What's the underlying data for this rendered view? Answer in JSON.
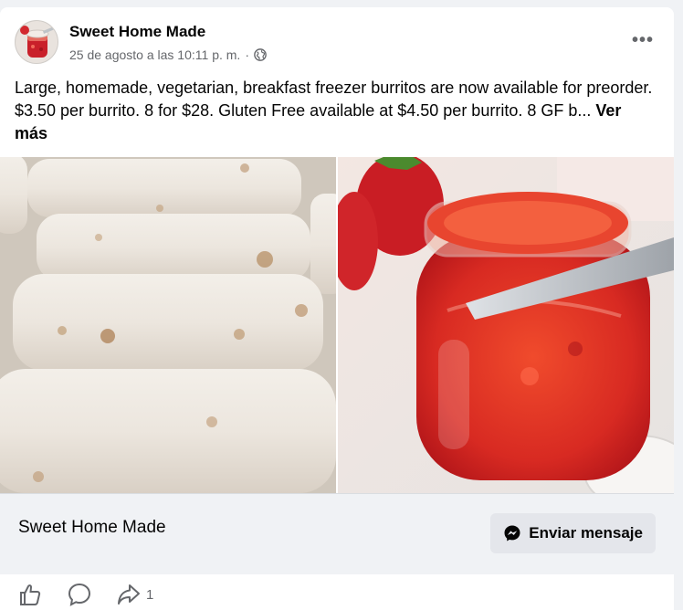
{
  "post": {
    "author": "Sweet Home Made",
    "date": "25 de agosto a las 10:11 p. m.",
    "separator": "·",
    "privacy_icon": "globe-icon",
    "more_icon": "more-horizontal-icon",
    "more_label": "•••",
    "text": "Large, homemade, vegetarian, breakfast freezer burritos are now available for preorder. $3.50 per burrito. 8 for $28. Gluten Free available at $4.50 per burrito. 8 GF b...",
    "see_more": "Ver más"
  },
  "photos": [
    {
      "subject": "breakfast-burritos-photo"
    },
    {
      "subject": "strawberry-jam-jar-photo"
    }
  ],
  "cta": {
    "page_name": "Sweet Home Made",
    "button_label": "Enviar mensaje",
    "button_icon": "messenger-icon"
  },
  "actions": {
    "like_icon": "thumbs-up-icon",
    "comment_icon": "comment-icon",
    "share_icon": "share-icon",
    "share_count": "1"
  },
  "colors": {
    "background": "#f0f2f5",
    "card": "#ffffff",
    "secondary_text": "#65676b",
    "button_bg": "#e4e6eb"
  }
}
